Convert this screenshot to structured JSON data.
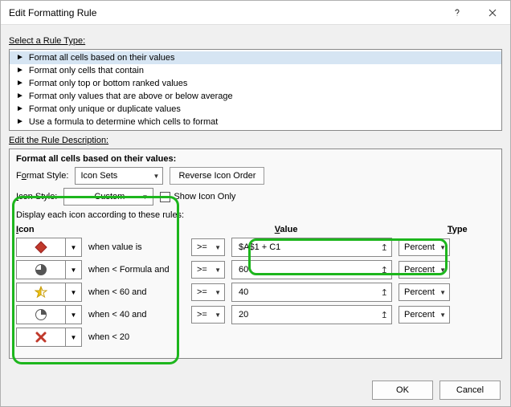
{
  "titlebar": {
    "title": "Edit Formatting Rule"
  },
  "section": {
    "select_rule_type": "Select a Rule Type:",
    "edit_rule_desc": "Edit the Rule Description:"
  },
  "rule_types": {
    "items": [
      {
        "label": "Format all cells based on their values"
      },
      {
        "label": "Format only cells that contain"
      },
      {
        "label": "Format only top or bottom ranked values"
      },
      {
        "label": "Format only values that are above or below average"
      },
      {
        "label": "Format only unique or duplicate values"
      },
      {
        "label": "Use a formula to determine which cells to format"
      }
    ]
  },
  "desc": {
    "heading": "Format all cells based on their values:",
    "format_style_label_pre": "F",
    "format_style_label_u": "o",
    "format_style_label_post": "rmat Style:",
    "format_style_value": "Icon Sets",
    "reverse_btn": "Reverse Icon Order",
    "icon_style_label_u": "I",
    "icon_style_label_post": "con Style:",
    "icon_style_value": "Custom",
    "show_icon_only": "Show Icon Only",
    "display_rules": "Display each icon according to these rules:",
    "header_icon": "Icon",
    "header_value_u": "V",
    "header_value_post": "alue",
    "header_type_u": "T",
    "header_type_post": "ype",
    "rows": [
      {
        "text": "when value is",
        "op": ">=",
        "value": "$A$1 + C1",
        "type": "Percent"
      },
      {
        "text": "when < Formula and",
        "op": ">=",
        "value": "60",
        "type": "Percent"
      },
      {
        "text": "when < 60 and",
        "op": ">=",
        "value": "40",
        "type": "Percent"
      },
      {
        "text": "when < 40 and",
        "op": ">=",
        "value": "20",
        "type": "Percent"
      },
      {
        "text": "when < 20",
        "op": "",
        "value": "",
        "type": ""
      }
    ]
  },
  "footer": {
    "ok": "OK",
    "cancel": "Cancel"
  },
  "icons": {
    "row0": "diamond-red",
    "row1": "pie-3q-gray",
    "row2": "star-half-yellow",
    "row3": "pie-1q-gray",
    "row4": "cross-red"
  }
}
